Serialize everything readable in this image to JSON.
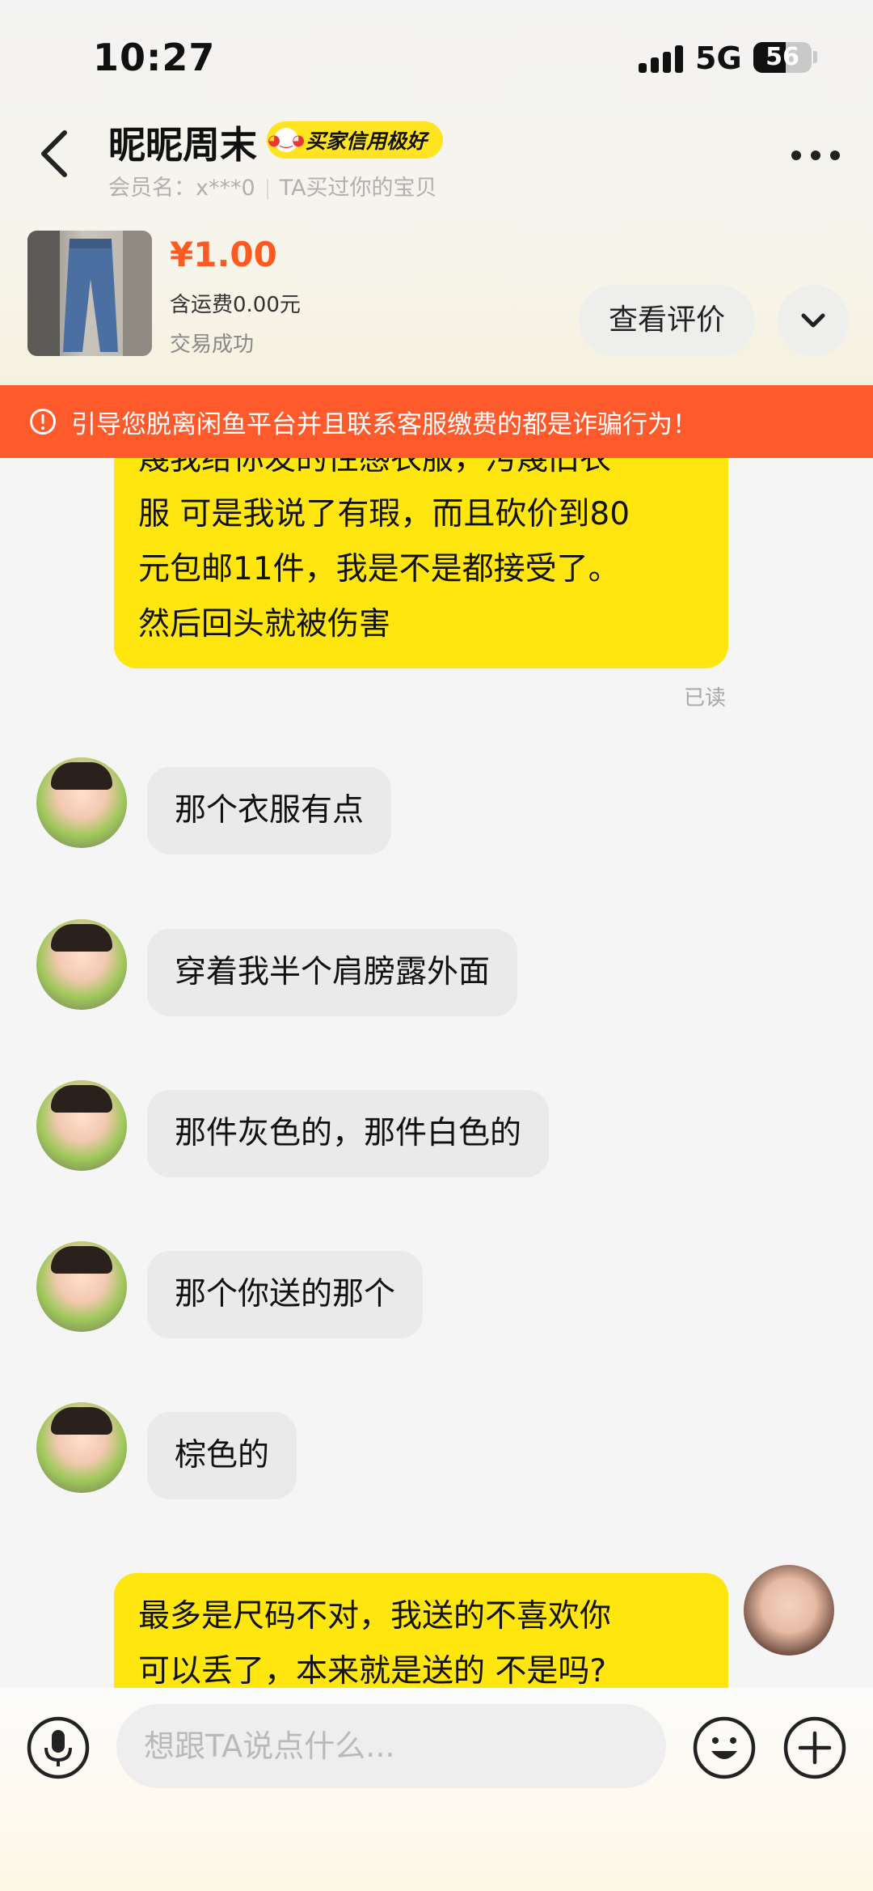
{
  "status_bar": {
    "time": "10:27",
    "network": "5G",
    "battery": "56",
    "battery_level": 0.56
  },
  "header": {
    "title": "昵昵周末",
    "credit_badge": "买家信用极好",
    "member_label": "会员名：x***0",
    "relation_label": "TA买过你的宝贝"
  },
  "product": {
    "price": "¥1.00",
    "shipping": "含运费0.00元",
    "status": "交易成功",
    "review_button": "查看评价"
  },
  "warning": {
    "text": "引导您脱离闲鱼平台并且联系客服缴费的都是诈骗行为！"
  },
  "messages": [
    {
      "from": "me",
      "lines": [
        "蔑我给你发的性感衣服，污蔑旧衣",
        "服 可是我说了有瑕，而且砍价到80",
        "元包邮11件，我是不是都接受了。",
        "然后回头就被伤害"
      ],
      "read": "已读"
    },
    {
      "from": "them",
      "text": "那个衣服有点"
    },
    {
      "from": "them",
      "text": "穿着我半个肩膀露外面"
    },
    {
      "from": "them",
      "text": "那件灰色的，那件白色的"
    },
    {
      "from": "them",
      "text": "那个你送的那个"
    },
    {
      "from": "them",
      "text": "棕色的"
    },
    {
      "from": "me",
      "lines": [
        "最多是尺码不对，我送的不喜欢你",
        "可以丢了，本来就是送的 不是吗?"
      ]
    }
  ],
  "input": {
    "placeholder": "想跟TA说点什么..."
  },
  "icons": {
    "back": "chevron-left-icon",
    "more": "more-dots-icon",
    "expand": "chevron-down-icon",
    "warning": "alert-circle-icon",
    "mic": "microphone-icon",
    "emoji": "emoji-icon",
    "plus": "plus-icon"
  },
  "colors": {
    "accent": "#ffe60f",
    "price": "#ff5a1f",
    "warning_bg": "#ff5a2c",
    "other_bubble": "#eaeaea"
  }
}
